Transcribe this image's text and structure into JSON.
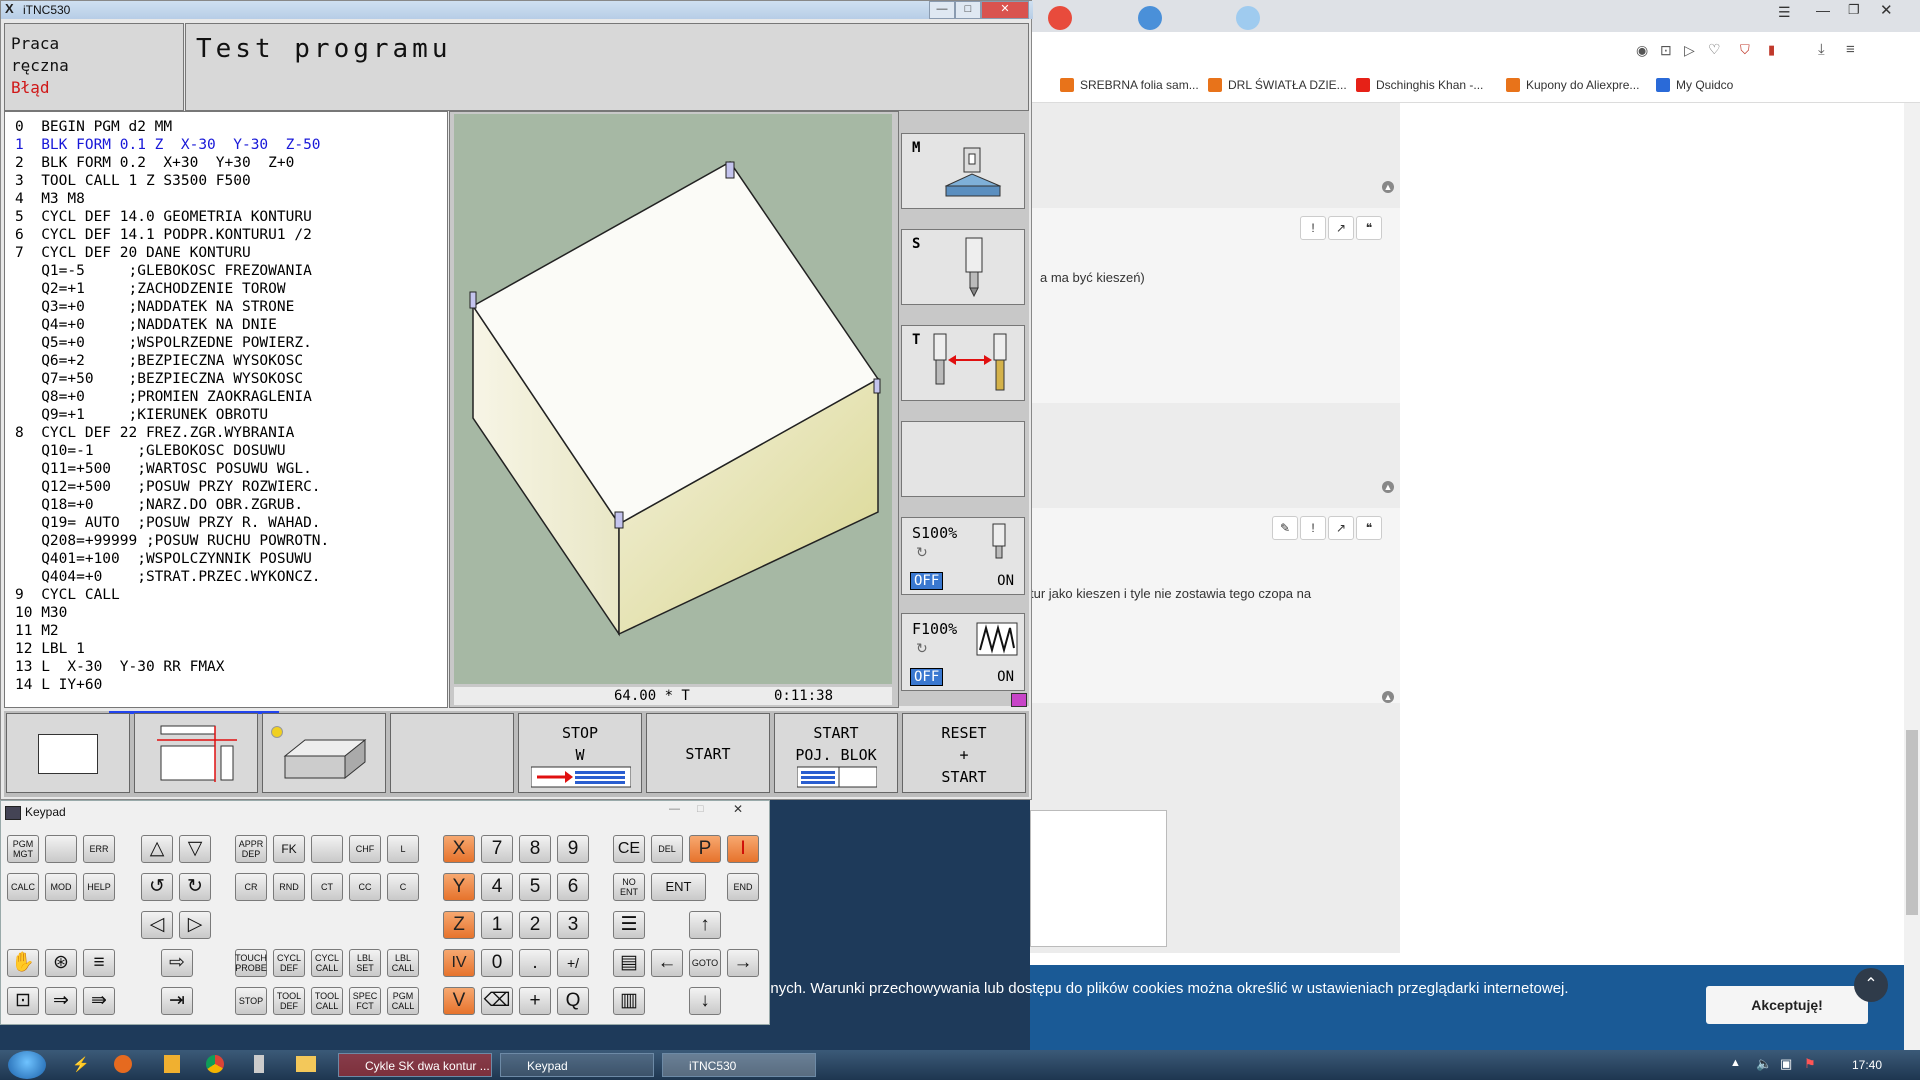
{
  "browser": {
    "bookmarks": [
      {
        "label": "SREBRNA folia sam...",
        "color": "#e8731a"
      },
      {
        "label": "DRL ŚWIATŁA DZIE...",
        "color": "#e8731a"
      },
      {
        "label": "Dschinghis Khan -...",
        "color": "#e62117"
      },
      {
        "label": "Kupony do Aliexpre...",
        "color": "#e8731a"
      },
      {
        "label": "My Quidco",
        "color": "#2a6ad8"
      }
    ],
    "posts": [
      {
        "text": "a ma być kieszeń)"
      },
      {
        "text": "tur jako kieszen i tyle nie zostawia tego czopa na"
      }
    ],
    "cookie_text": "onalnych. Warunki przechowywania lub dostępu do plików cookies można określić w ustawieniach przeglądarki internetowej.",
    "accept_label": "Akceptuję!"
  },
  "itnc": {
    "window_title": "iTNC530",
    "mode_lines": [
      "Praca",
      "ręczna",
      "Błąd"
    ],
    "program_title": "Test programu",
    "program_lines": [
      "0  BEGIN PGM d2 MM",
      "1  BLK FORM 0.1 Z  X-30  Y-30  Z-50",
      "2  BLK FORM 0.2  X+30  Y+30  Z+0",
      "3  TOOL CALL 1 Z S3500 F500",
      "4  M3 M8",
      "5  CYCL DEF 14.0 GEOMETRIA KONTURU",
      "6  CYCL DEF 14.1 PODPR.KONTURU1 /2",
      "7  CYCL DEF 20 DANE KONTURU",
      "   Q1=-5     ;GLEBOKOSC FREZOWANIA",
      "   Q2=+1     ;ZACHODZENIE TOROW",
      "   Q3=+0     ;NADDATEK NA STRONE",
      "   Q4=+0     ;NADDATEK NA DNIE",
      "   Q5=+0     ;WSPOLRZEDNE POWIERZ.",
      "   Q6=+2     ;BEZPIECZNA WYSOKOSC",
      "   Q7=+50    ;BEZPIECZNA WYSOKOSC",
      "   Q8=+0     ;PROMIEN ZAOKRAGLENIA",
      "   Q9=+1     ;KIERUNEK OBROTU",
      "8  CYCL DEF 22 FREZ.ZGR.WYBRANIA",
      "   Q10=-1     ;GLEBOKOSC DOSUWU",
      "   Q11=+500   ;WARTOSC POSUWU WGL.",
      "   Q12=+500   ;POSUW PRZY ROZWIERC.",
      "   Q18=+0     ;NARZ.DO OBR.ZGRUB.",
      "   Q19= AUTO  ;POSUW PRZY R. WAHAD.",
      "   Q208=+99999 ;POSUW RUCHU POWROTN.",
      "   Q401=+100  ;WSPOLCZYNNIK POSUWU",
      "   Q404=+0    ;STRAT.PRZEC.WYKONCZ.",
      "9  CYCL CALL",
      "10 M30",
      "11 M2",
      "12 LBL 1",
      "13 L  X-30  Y-30 RR FMAX",
      "14 L IY+60"
    ],
    "status": {
      "left": "64.00 * T",
      "time": "0:11:38"
    },
    "side": {
      "m": "M",
      "s": "S",
      "t": "T",
      "spindle": "S100%",
      "feed": "F100%",
      "off": "OFF",
      "on": "ON"
    },
    "softkeys": {
      "stop": [
        "STOP",
        "W"
      ],
      "start": "START",
      "start_block": [
        "START",
        "POJ. BLOK"
      ],
      "reset": [
        "RESET",
        "+",
        "START"
      ]
    }
  },
  "keypad": {
    "title": "Keypad",
    "keys": {
      "pgm_mgt": "PGM MGT",
      "err": "ERR",
      "calc": "CALC",
      "mod": "MOD",
      "help": "HELP",
      "appr": "APPR DEP",
      "fk": "FK",
      "chf": "CHF",
      "l": "L",
      "cr": "CR",
      "rnd": "RND",
      "ct": "CT",
      "cc": "CC",
      "c": "C",
      "touch": "TOUCH PROBE",
      "cycl_def": "CYCL DEF",
      "cycl_call": "CYCL CALL",
      "lbl_set": "LBL SET",
      "lbl_call": "LBL CALL",
      "stop": "STOP",
      "tool_def": "TOOL DEF",
      "tool_call": "TOOL CALL",
      "spec_fct": "SPEC FCT",
      "pgm_call": "PGM CALL",
      "x": "X",
      "y": "Y",
      "z": "Z",
      "iv": "IV",
      "v": "V",
      "d7": "7",
      "d8": "8",
      "d9": "9",
      "d4": "4",
      "d5": "5",
      "d6": "6",
      "d1": "1",
      "d2": "2",
      "d3": "3",
      "d0": "0",
      "dot": ".",
      "pm": "+/",
      "q": "Q",
      "p": "P",
      "i": "I",
      "ce": "CE",
      "del": "DEL",
      "no_ent": "NO ENT",
      "ent": "ENT",
      "end": "END",
      "goto": "GOTO"
    }
  },
  "taskbar": {
    "items": [
      "Cykle SK dwa kontur ...",
      "Keypad",
      "iTNC530"
    ],
    "clock": "17:40"
  }
}
